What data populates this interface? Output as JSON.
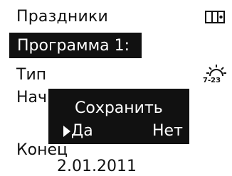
{
  "header": {
    "title": "Праздники",
    "menu_icon": "panel-toggle-icon"
  },
  "program": {
    "label": "Программа 1:"
  },
  "fields": {
    "type_label": "Тип",
    "type_icon": "sun-holiday-icon",
    "type_icon_text": "7-23",
    "start_label": "Нач",
    "end_label": "Конец",
    "end_value": "2.01.2011"
  },
  "dialog": {
    "title": "Сохранить",
    "selected_icon": "selector-arrow-icon",
    "options": [
      "Да",
      "Нет"
    ],
    "selected_option": "Да"
  }
}
